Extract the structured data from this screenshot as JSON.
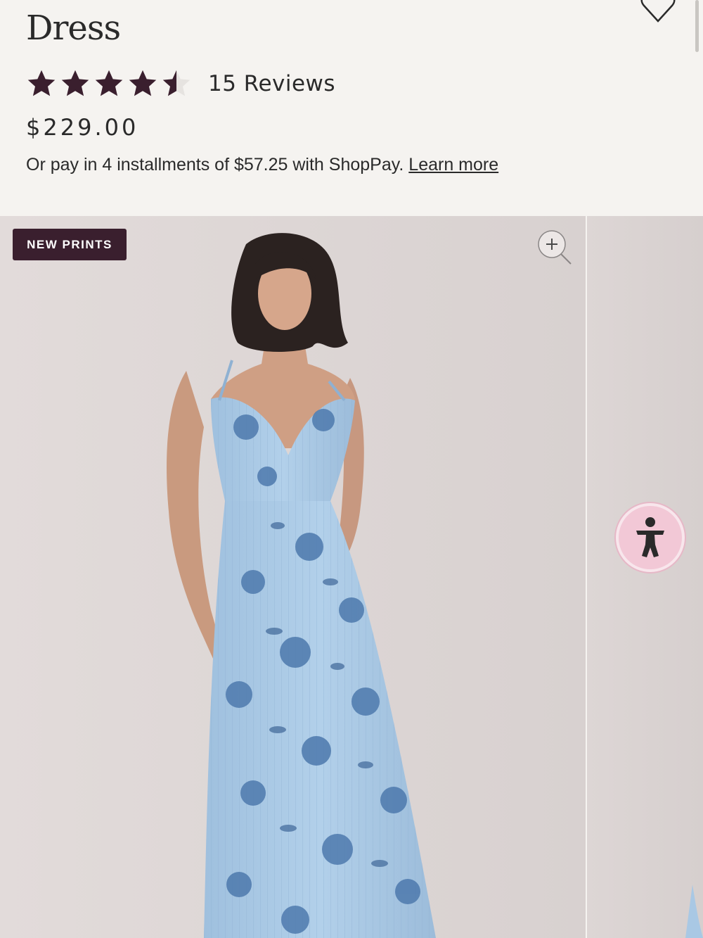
{
  "product": {
    "title": "Dress",
    "rating": 4.5,
    "rating_max": 5,
    "reviews_label": "15 Reviews",
    "price": "$229.00",
    "installments_text": "Or pay in 4 installments of $57.25 with ShopPay.",
    "learn_more_label": "Learn more"
  },
  "gallery": {
    "badge_label": "NEW PRINTS",
    "zoom_icon": "zoom-in-icon"
  },
  "colors": {
    "star": "#3a1f2e",
    "badge_bg": "#3a1f2e",
    "accessibility_bg": "#f2c8d6",
    "dress": "#a9c8e4",
    "floral": "#4d79ad"
  },
  "icons": {
    "wishlist": "heart-outline-icon",
    "accessibility": "accessibility-person-icon"
  }
}
